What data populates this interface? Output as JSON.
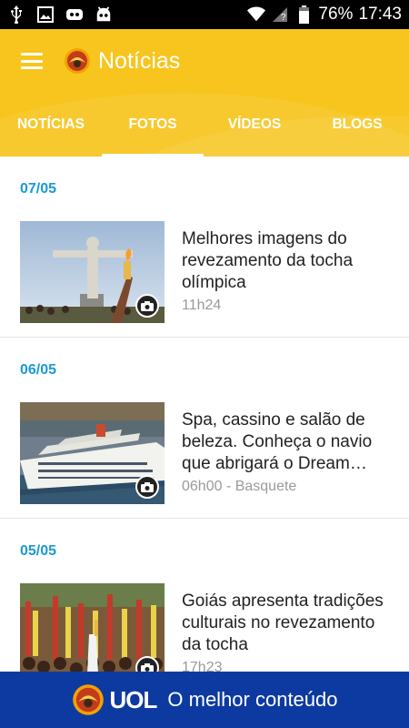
{
  "status_bar": {
    "battery": "76%",
    "time": "17:43",
    "icons": [
      "usb-icon",
      "image-icon",
      "cyanogenmod-icon",
      "android-icon",
      "wifi-icon",
      "signal-icon",
      "battery-icon"
    ]
  },
  "app_bar": {
    "title": "Notícias",
    "menu_icon": "menu-icon",
    "logo_icon": "uol-logo-icon",
    "accent_color": "#f7c51d"
  },
  "tabs": [
    {
      "label": "NOTÍCIAS",
      "active": false
    },
    {
      "label": "FOTOS",
      "active": true
    },
    {
      "label": "VÍDEOS",
      "active": false
    },
    {
      "label": "BLOGS",
      "active": false
    }
  ],
  "feed": {
    "date_color": "#1a9ad6",
    "sections": [
      {
        "date": "07/05",
        "items": [
          {
            "title": "Melhores imagens do revezamento da tocha olímpica",
            "meta": "11h24",
            "badge_icon": "camera-icon"
          }
        ]
      },
      {
        "date": "06/05",
        "items": [
          {
            "title": "Spa, cassino e salão de beleza. Conheça o navio que abrigará o Dream…",
            "meta": "06h00 - Basquete",
            "badge_icon": "camera-icon"
          }
        ]
      },
      {
        "date": "05/05",
        "items": [
          {
            "title": "Goiás apresenta tradições culturais no revezamento da tocha",
            "meta": "17h23",
            "badge_icon": "camera-icon"
          }
        ]
      }
    ]
  },
  "footer": {
    "brand": "UOL",
    "slogan": "O melhor conteúdo",
    "background": "#0d3aa0"
  }
}
